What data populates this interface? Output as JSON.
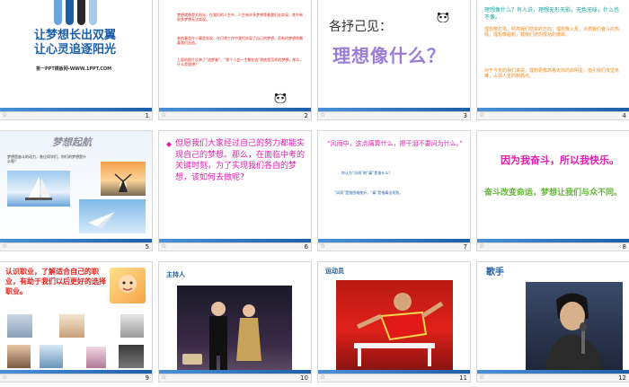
{
  "colors": {
    "accent_blue": "#4a90d9",
    "dark_blue": "#1c5fa8",
    "sky_blue": "#2fa9e8",
    "magenta": "#e01fae",
    "red": "#e0201a",
    "purple": "#9a7cd6",
    "orange": "#f08a1c",
    "teal": "#1aa79c",
    "green": "#63b534",
    "gray_bar": "#bfbfbf"
  },
  "footer_icon": "star-icon",
  "slides": [
    {
      "number": "1",
      "title_line1": "让梦想长出双翼",
      "title_line2": "让心灵追逐阳光",
      "site": "第一PPT模板网-WWW.1PPT.COM"
    },
    {
      "number": "2",
      "p1": "梦想就像是太阳光，在我们的人生中，人生有许多梦想等着我们去实现，其中有很多梦想无法实现。",
      "p2": "有的事会在小事里实现，在日常工作中我们实现了自己的梦想，而有的梦想则需要我们去追。",
      "p3": "上面的图片反映了“追梦者”，“那个人会一生都在追”到底是怎样的梦想，那么，什么是理想？"
    },
    {
      "number": "3",
      "heading": "各抒己见：",
      "big": "理想像什么？"
    },
    {
      "number": "4",
      "q": "理想像什么？有人说，理想无形无影，无色无味，什么也不像。",
      "p1": "理想像灯塔，照亮我们前进的方向；理想像火炬，点燃我们奋斗的热情；理想像船帆，载我们驶向成功的彼岸。",
      "p2": "对于今天的我们来说，理想更像高悬天际的启明星，指引我们攻坚克难，占领人生的制高点。"
    },
    {
      "number": "5",
      "title": "梦想起航",
      "text": "梦想是奋斗的动力，各位同学们，你们的梦想是什么呢？"
    },
    {
      "number": "6",
      "text": "但愿我们大家经过自己的努力都能实现自己的梦想。那么，在面临中考的关键时刻，为了实现我们各自的梦想，该如何去做呢？"
    },
    {
      "number": "7",
      "quote": "“风雨中，这点痛算什么，擦干泪不要问为什么。”",
      "q1": "你认为“风雨”和“痛”是指什么？",
      "a1": "“风雨”是指困难挫折，“痛”是指痛苦失败。"
    },
    {
      "number": "8",
      "line1": "因为我奋斗，所以我快乐。",
      "line2": "奋斗改变命运，梦想让我们与众不同。"
    },
    {
      "number": "9",
      "text": "认识职业，了解适合自己的职业，有助于我们以后更好的选择职业。"
    },
    {
      "number": "10",
      "label": "主持人"
    },
    {
      "number": "11",
      "label": "运动员"
    },
    {
      "number": "12",
      "label": "歌手"
    }
  ]
}
